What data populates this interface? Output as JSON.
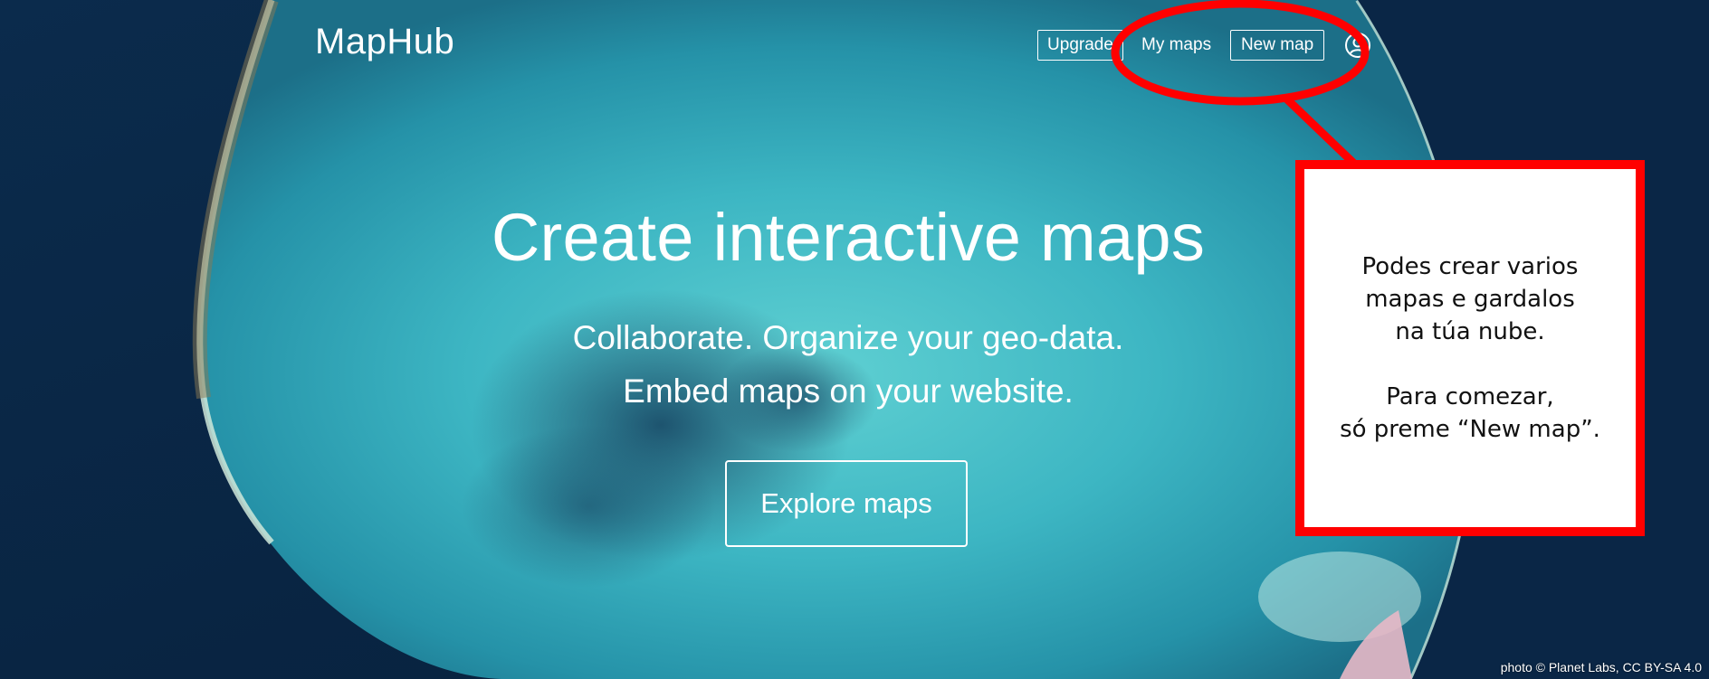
{
  "header": {
    "logo": "MapHub",
    "nav": {
      "upgrade": "Upgrade",
      "my_maps": "My maps",
      "new_map": "New map"
    },
    "user_icon": "user-circle-icon"
  },
  "hero": {
    "title": "Create interactive maps",
    "subtitle_line1": "Collaborate. Organize your geo-data.",
    "subtitle_line2": "Embed maps on your website.",
    "cta": "Explore maps"
  },
  "annotation": {
    "paragraph1": [
      "Podes crear varios",
      "mapas e gardalos",
      "na túa nube."
    ],
    "paragraph2": [
      "Para comezar,",
      "só preme “New map”."
    ],
    "highlight_color": "#ff0000"
  },
  "credit": "photo © Planet Labs, CC BY-SA 4.0",
  "colors": {
    "ocean_deep": "#0a2a4a",
    "lagoon": "#3fb8c4",
    "reef": "#1e6e80"
  }
}
